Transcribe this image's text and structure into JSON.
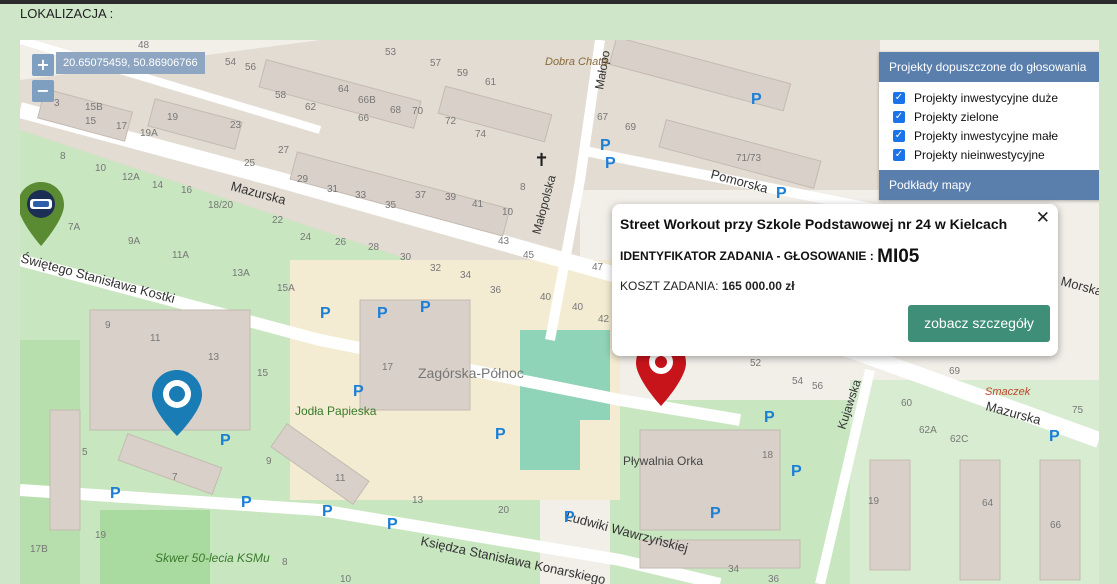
{
  "section_label": "LOKALIZACJA :",
  "map": {
    "zoom_in": "+",
    "zoom_out": "−",
    "coords": "20.65075459, 50.86906766",
    "colors": {
      "background": "#f2efe9",
      "road": "#ffffff",
      "park": "#c8e6bf",
      "building": "#d9d0c9",
      "water": "#aad3df",
      "pitch": "#8fd3b8",
      "parking_text": "#1c7fd6",
      "layers_header": "#5b7fad",
      "button": "#3f8f78",
      "pin_red": "#c7141b",
      "pin_blue": "#1a7cb5",
      "pin_green": "#5a8a32"
    },
    "street_labels": [
      "Mazurska",
      "Świętego Stanisława Kostki",
      "Małopolska",
      "Pomorska",
      "Mazurska",
      "Kujawska",
      "Ludwiki Wawrzyńskiej",
      "Księdza Stanisława Konarskiego",
      "Morska",
      "Małopo",
      "Zagórska-Północ",
      "Jodła Papieska",
      "Pływalnia Orka",
      "Dobra Chata",
      "Skwer 50-lecia KSMu",
      "Smaczek"
    ],
    "house_numbers": [
      "48",
      "54",
      "56",
      "53",
      "57",
      "59",
      "61",
      "58",
      "62",
      "64",
      "66B",
      "66",
      "68",
      "70",
      "72",
      "74",
      "3",
      "15B",
      "15",
      "17",
      "19A",
      "19",
      "23",
      "27",
      "25",
      "29",
      "31",
      "33",
      "35",
      "37",
      "39",
      "41",
      "10",
      "8",
      "43",
      "45",
      "47",
      "8",
      "10",
      "12A",
      "14",
      "16",
      "18/20",
      "22",
      "24",
      "26",
      "28",
      "30",
      "32",
      "34",
      "36",
      "40",
      "40",
      "42",
      "7A",
      "9A",
      "11A",
      "13A",
      "15A",
      "9",
      "11",
      "13",
      "15",
      "17",
      "5",
      "7",
      "9",
      "11",
      "13",
      "20",
      "17B",
      "19",
      "8",
      "10",
      "34",
      "36",
      "67",
      "69",
      "71/73",
      "52",
      "54",
      "56",
      "69",
      "60",
      "62A",
      "62C",
      "75",
      "19",
      "64",
      "66",
      "18"
    ],
    "parking_glyph": "P"
  },
  "layers": {
    "header": "Projekty dopuszczone do głosowania",
    "items": [
      {
        "label": "Projekty inwestycyjne duże",
        "checked": true
      },
      {
        "label": "Projekty zielone",
        "checked": true
      },
      {
        "label": "Projekty inwestycyjne małe",
        "checked": true
      },
      {
        "label": "Projekty nieinwestycyjne",
        "checked": true
      }
    ],
    "footer": "Podkłady mapy"
  },
  "popup": {
    "title": "Street Workout przy Szkole Podstawowej nr 24 w Kielcach",
    "id_label": "IDENTYFIKATOR ZADANIA - GŁOSOWANIE :",
    "id_value": "MI05",
    "cost_label": "KOSZT ZADANIA:",
    "cost_value": "165 000.00 zł",
    "button": "zobacz szczegóły",
    "close": "✕"
  }
}
